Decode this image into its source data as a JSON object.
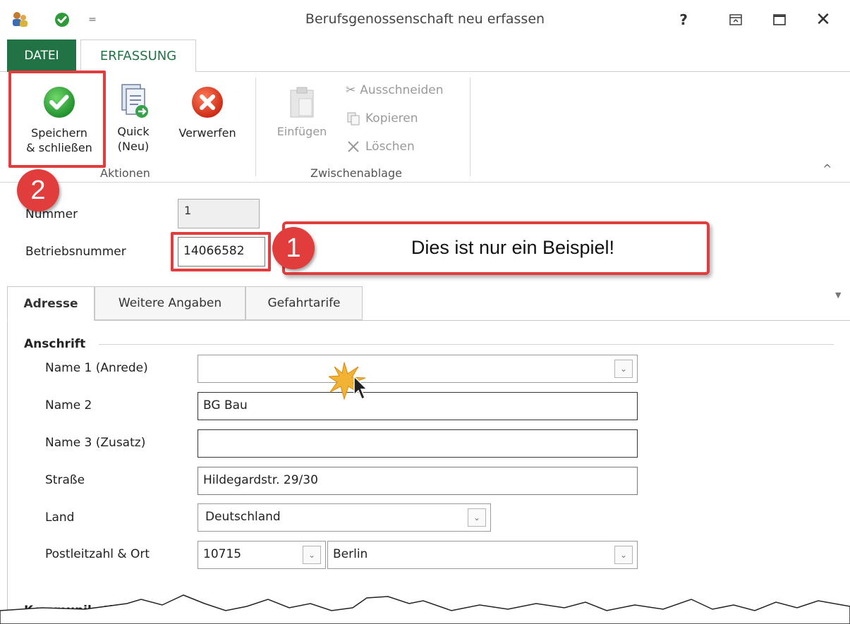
{
  "window": {
    "title": "Berufsgenossenschaft neu erfassen",
    "help": "?",
    "close": "✕",
    "quick_access_menu": "="
  },
  "ribbon_tabs": [
    "DATEI",
    "ERFASSUNG"
  ],
  "ribbon": {
    "actions": {
      "save_close": [
        "Speichern",
        "& schließen"
      ],
      "quick_new": [
        "Quick",
        "(Neu)"
      ],
      "discard": "Verwerfen",
      "group_label": "Aktionen"
    },
    "clipboard": {
      "paste": "Einfügen",
      "cut": "Ausschneiden",
      "copy": "Kopieren",
      "delete": "Löschen",
      "group_label": "Zwischenablage"
    },
    "collapse": "^"
  },
  "annotations": {
    "badge1": "1",
    "badge2": "2",
    "callout": "Dies ist nur ein Beispiel!"
  },
  "header": {
    "nummer_label": "Nummer",
    "nummer_value": "1",
    "betriebsnummer_label": "Betriebsnummer",
    "betriebsnummer_value": "14066582"
  },
  "tabs": [
    "Adresse",
    "Weitere Angaben",
    "Gefahrtarife"
  ],
  "anschrift": {
    "section_title": "Anschrift",
    "fields": {
      "name1_label": "Name 1 (Anrede)",
      "name1_value": "",
      "name2_label": "Name 2",
      "name2_value": "BG Bau",
      "name3_label": "Name 3 (Zusatz)",
      "name3_value": "",
      "strasse_label": "Straße",
      "strasse_value": "Hildegardstr. 29/30",
      "land_label": "Land",
      "land_value": "Deutschland",
      "plzort_label": "Postleitzahl & Ort",
      "plz_value": "10715",
      "ort_value": "Berlin"
    }
  },
  "kommunikation": {
    "section_title": "Kommunikatio"
  },
  "colors": {
    "accent_green": "#217346",
    "highlight_red": "#e23d3d"
  }
}
